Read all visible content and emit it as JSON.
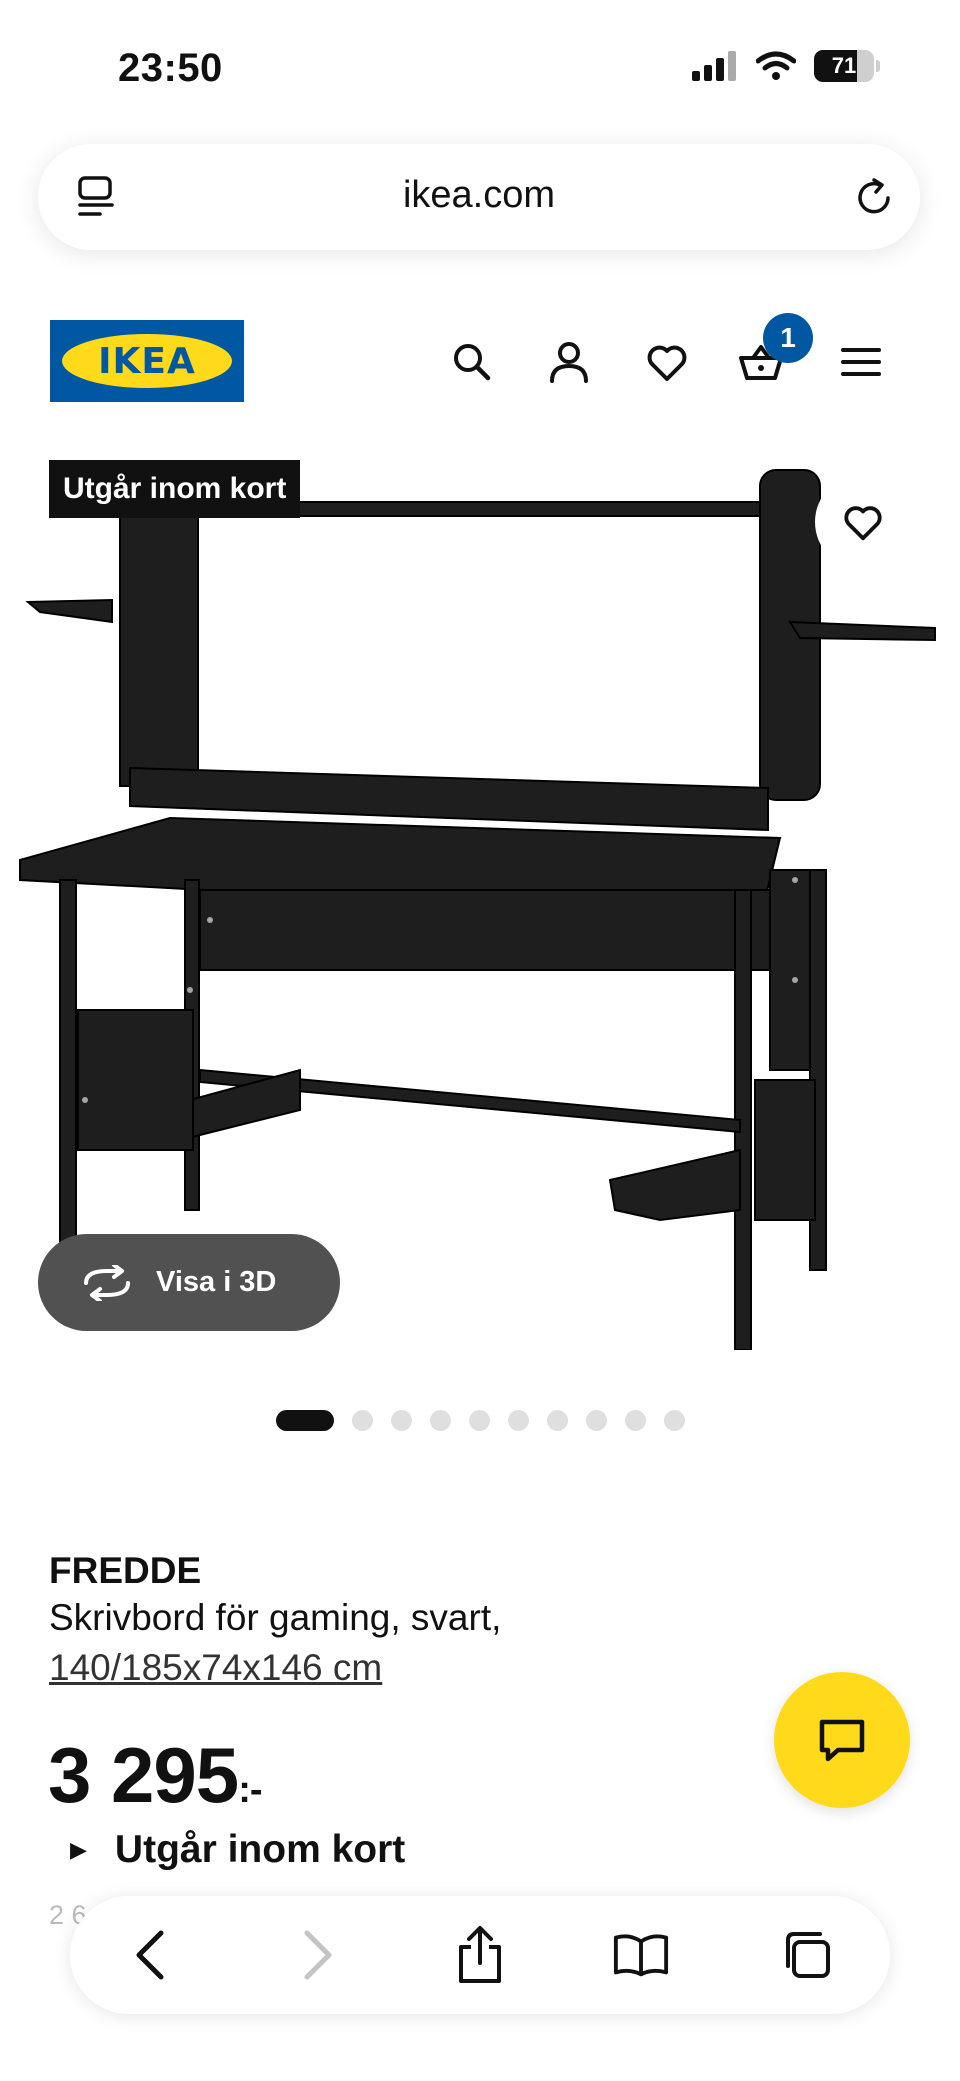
{
  "status_bar": {
    "time": "23:50",
    "battery": "71",
    "battery_level": 0.71
  },
  "browser": {
    "url": "ikea.com"
  },
  "header": {
    "logo_text": "IKEA",
    "cart_count": "1"
  },
  "product": {
    "tag": "Utgår inom kort",
    "view_3d_label": "Visa i 3D",
    "image_count": 10,
    "active_image_index": 0,
    "name": "FREDDE",
    "description": "Skrivbord för gaming, svart,",
    "measurements": "140/185x74x146 cm",
    "price": "3 295",
    "price_suffix": ":-",
    "availability": "Utgår inom kort",
    "partial_text": "2 6"
  },
  "colors": {
    "ikea_blue": "#0058a3",
    "ikea_yellow": "#ffda1a"
  },
  "icons": {
    "header": [
      "search-icon",
      "user-icon",
      "heart-icon",
      "cart-icon",
      "menu-icon"
    ],
    "toolbar": [
      "back-icon",
      "forward-icon",
      "share-icon",
      "bookmarks-icon",
      "tabs-icon"
    ]
  }
}
